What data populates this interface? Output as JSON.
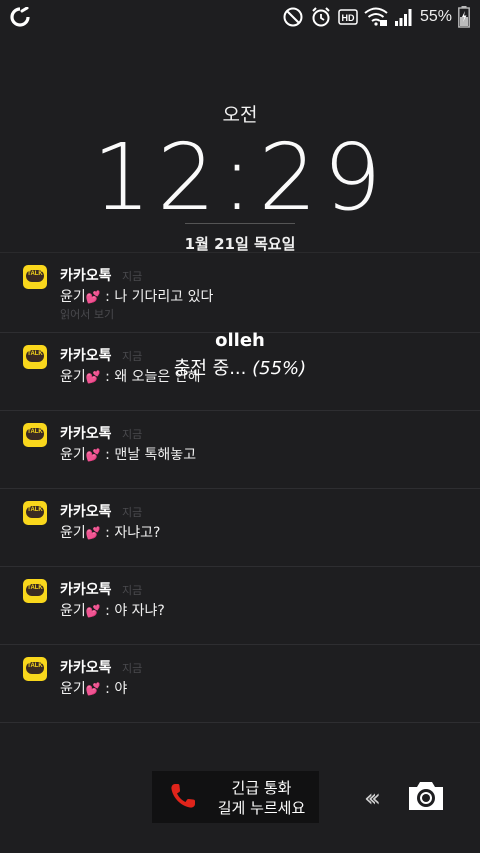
{
  "status_bar": {
    "carrier_icon": "olleh-logo-icon",
    "icons": [
      "do-not-disturb-icon",
      "alarm-icon",
      "hd-voice-icon",
      "wifi-icon",
      "signal-icon"
    ],
    "battery_percent": "55%",
    "battery_icon": "battery-charging-icon"
  },
  "lock_screen": {
    "ampm": "오전",
    "time": "12:29",
    "date": "1월 21일 목요일"
  },
  "notifications": [
    {
      "app": "카카오톡",
      "time": "지금",
      "sender": "윤기",
      "message": ": 나 기다리고 있다",
      "action": "읽어서 보기"
    },
    {
      "app": "카카오톡",
      "time": "지금",
      "sender": "윤기",
      "message": ": 왜 오늘은 안해"
    },
    {
      "app": "카카오톡",
      "time": "지금",
      "sender": "윤기",
      "message": ": 맨날 톡해놓고"
    },
    {
      "app": "카카오톡",
      "time": "지금",
      "sender": "윤기",
      "message": ": 자냐고?"
    },
    {
      "app": "카카오톡",
      "time": "지금",
      "sender": "윤기",
      "message": ": 야 자냐?"
    },
    {
      "app": "카카오톡",
      "time": "지금",
      "sender": "윤기",
      "message": ": 야"
    }
  ],
  "app_icon_text": "TALK",
  "overlay": {
    "carrier": "olleh",
    "charging": "충전 중... ",
    "charging_pct": "(55%)"
  },
  "emergency": {
    "line1": "긴급 통화",
    "line2": "길게 누르세요"
  },
  "colors": {
    "background": "#1e1e20",
    "kakao_yellow": "#f9d71c",
    "phone_red": "#e0241b",
    "heart_pink": "#ff6fb5"
  }
}
